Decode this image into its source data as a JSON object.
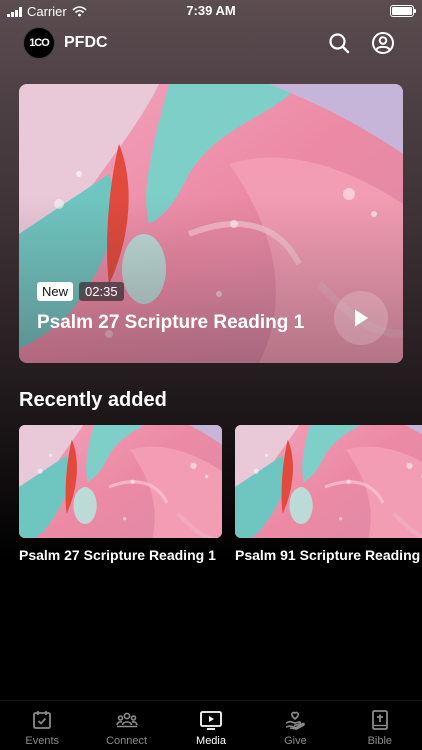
{
  "status_bar": {
    "carrier": "Carrier",
    "time": "7:39 AM"
  },
  "header": {
    "logo_text": "1CO",
    "title": "PFDC"
  },
  "hero": {
    "badge_new": "New",
    "duration": "02:35",
    "title": "Psalm 27 Scripture Reading 1"
  },
  "recently_added": {
    "title": "Recently added",
    "items": [
      {
        "title": "Psalm 27 Scripture Reading 1"
      },
      {
        "title": "Psalm 91 Scripture Reading"
      }
    ]
  },
  "tabs": [
    {
      "label": "Events",
      "icon": "calendar-icon"
    },
    {
      "label": "Connect",
      "icon": "people-icon"
    },
    {
      "label": "Media",
      "icon": "media-icon",
      "active": true
    },
    {
      "label": "Give",
      "icon": "give-icon"
    },
    {
      "label": "Bible",
      "icon": "bible-icon"
    }
  ],
  "colors": {
    "background": "#000000",
    "text": "#ffffff",
    "inactive_tab": "#8a8a8a"
  }
}
